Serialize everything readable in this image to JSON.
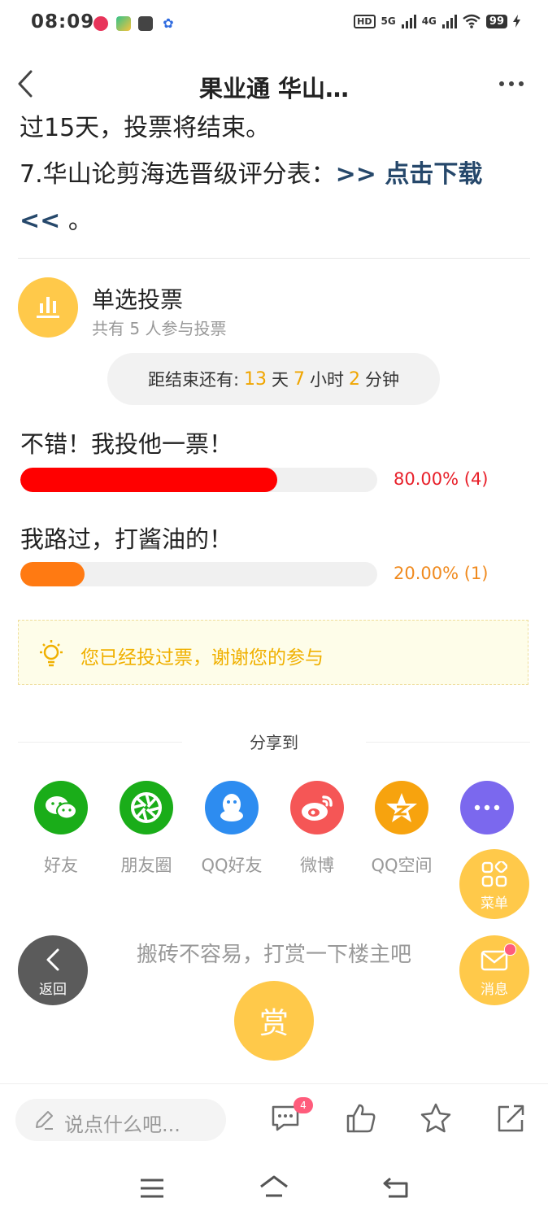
{
  "status_bar": {
    "time": "08:09",
    "network_hd": "HD",
    "network_5g": "5G",
    "network_4g": "4G",
    "battery": "99"
  },
  "header": {
    "title": "果业通 华山…"
  },
  "article": {
    "line1": "过15天，投票将结束。",
    "line2_prefix": "7.华山论剪海选晋级评分表：",
    "download_link": ">> 点击下载",
    "line3_link": "<<",
    "line3_suffix": " 。"
  },
  "vote": {
    "title": "单选投票",
    "participants": "共有 5 人参与投票",
    "countdown_prefix": "距结束还有:",
    "days": "13",
    "days_unit": "天",
    "hours": "7",
    "hours_unit": "小时",
    "minutes": "2",
    "minutes_unit": "分钟",
    "options": [
      {
        "label": "不错！我投他一票！",
        "percent_text": "80.00% (4)",
        "fraction": 0.8,
        "color": "#ff0000"
      },
      {
        "label": "我路过，打酱油的！",
        "percent_text": "20.00% (1)",
        "fraction": 0.2,
        "color": "#ff7a12"
      }
    ],
    "notice": "您已经投过票，谢谢您的参与"
  },
  "share": {
    "title": "分享到",
    "items": [
      {
        "label": "好友",
        "icon": "wechat-icon",
        "color": "#1aad19"
      },
      {
        "label": "朋友圈",
        "icon": "moments-icon",
        "color": "#1aad19"
      },
      {
        "label": "QQ好友",
        "icon": "qq-icon",
        "color": "#2d8cf0"
      },
      {
        "label": "微博",
        "icon": "weibo-icon",
        "color": "#f55656"
      },
      {
        "label": "QQ空间",
        "icon": "qzone-icon",
        "color": "#f7a30e"
      },
      {
        "label": "",
        "icon": "more-icon",
        "color": "#7b68ee"
      }
    ]
  },
  "floating": {
    "menu_label": "菜单",
    "message_label": "消息",
    "back_label": "返回"
  },
  "reward": {
    "prompt": "搬砖不容易，打赏一下楼主吧",
    "button": "赏"
  },
  "bottom_bar": {
    "comment_placeholder": "说点什么吧...",
    "comment_count": "4"
  },
  "colors": {
    "accent": "#ffc94a",
    "link": "#26486b",
    "countdown_number": "#f0a500"
  }
}
